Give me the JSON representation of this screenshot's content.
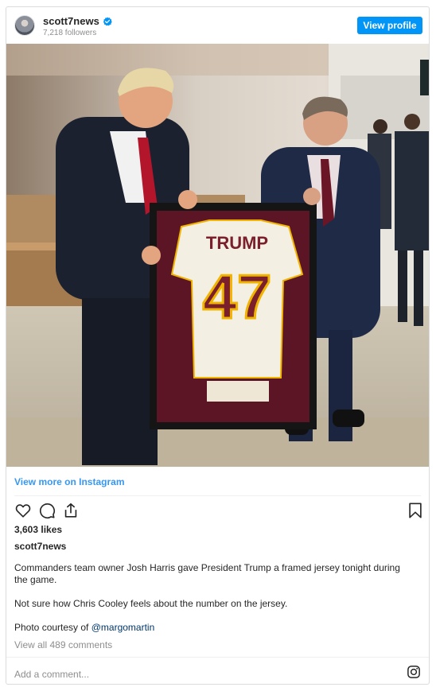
{
  "header": {
    "username": "scott7news",
    "followers": "7,218 followers",
    "view_profile_label": "View profile",
    "verified_icon": "verified-badge-icon",
    "avatar_icon": "profile-avatar"
  },
  "photo": {
    "jersey_name": "TRUMP",
    "jersey_number": "47"
  },
  "links": {
    "view_more": "View more on Instagram"
  },
  "actions": {
    "like_icon": "heart-icon",
    "comment_icon": "comment-icon",
    "share_icon": "share-icon",
    "save_icon": "bookmark-icon"
  },
  "post": {
    "likes": "3,603 likes",
    "username": "scott7news",
    "caption_line1": "Commanders team owner Josh Harris gave President Trump a framed jersey tonight during the game.",
    "caption_line2": "Not sure how Chris Cooley feels about the number on the jersey.",
    "caption_credit_prefix": "Photo courtesy of",
    "caption_mention": "@margomartin",
    "comments_link": "View all 489 comments"
  },
  "footer": {
    "add_comment_placeholder": "Add a comment...",
    "instagram_icon": "instagram-icon"
  },
  "colors": {
    "primary_blue": "#0095f6",
    "link_blue": "#3897f0",
    "mention_blue": "#00376b",
    "secondary_text": "#8e8e8e",
    "jersey_burgundy": "#7a1f2b",
    "jersey_gold": "#f0b400"
  }
}
